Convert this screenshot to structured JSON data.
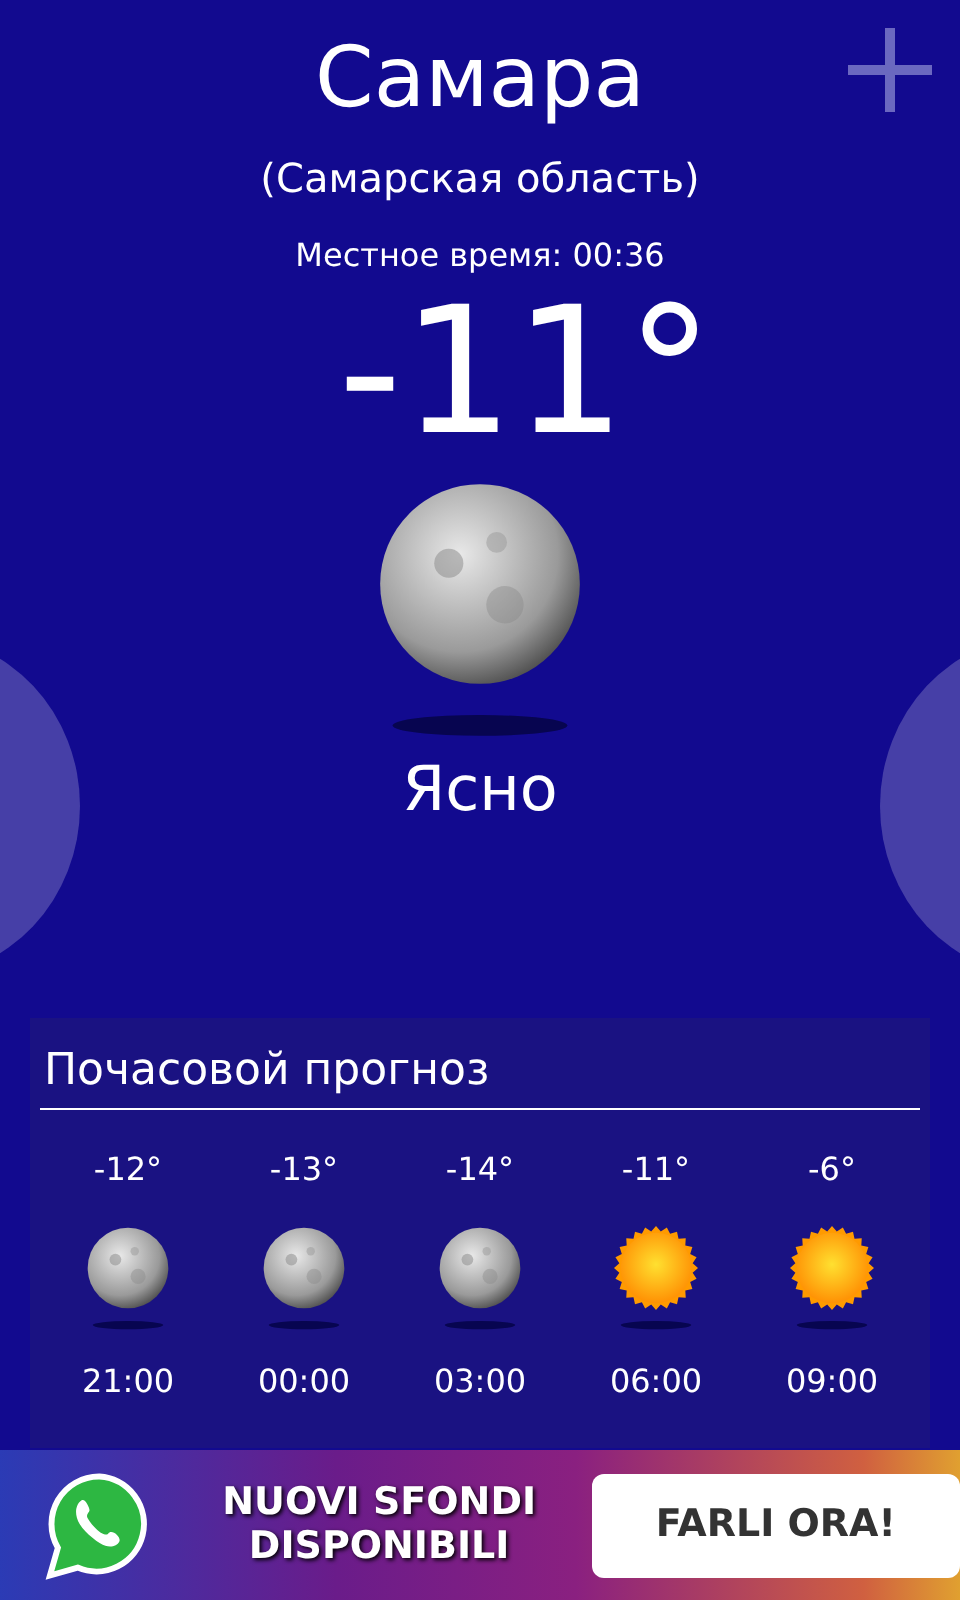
{
  "city": "Самара",
  "region": "(Самарская область)",
  "local_time": "Местное время: 00:36",
  "temperature": "-11°",
  "current": {
    "kind": "moon",
    "condition": "Ясно"
  },
  "hourly": {
    "title": "Почасовой прогноз",
    "items": [
      {
        "temp": "-12°",
        "kind": "moon",
        "time": "21:00"
      },
      {
        "temp": "-13°",
        "kind": "moon",
        "time": "00:00"
      },
      {
        "temp": "-14°",
        "kind": "moon",
        "time": "03:00"
      },
      {
        "temp": "-11°",
        "kind": "sun",
        "time": "06:00"
      },
      {
        "temp": "-6°",
        "kind": "sun",
        "time": "09:00"
      }
    ]
  },
  "ad": {
    "headline": "NUOVI SFONDI DISPONIBILI",
    "button": "FARLI ORA!"
  }
}
